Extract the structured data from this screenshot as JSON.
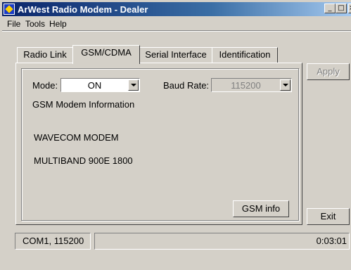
{
  "window": {
    "title": "ArWest Radio Modem  -  Dealer",
    "min": "_",
    "max": "□",
    "close": "×"
  },
  "menu": {
    "file": "File",
    "tools": "Tools",
    "help": "Help"
  },
  "tabs": [
    "Radio Link",
    "GSM/CDMA",
    "Serial Interface",
    "Identification"
  ],
  "active_tab": "GSM/CDMA",
  "gsm": {
    "mode_label": "Mode:",
    "mode_value": "ON",
    "baud_label": "Baud Rate:",
    "baud_value": "115200",
    "info_heading": "GSM Modem Information",
    "info_line1": "WAVECOM MODEM",
    "info_line2": "MULTIBAND  900E  1800",
    "gsm_info_button": "GSM info"
  },
  "buttons": {
    "apply": "Apply",
    "exit": "Exit"
  },
  "status": {
    "port": "COM1, 115200",
    "time": "0:03:01"
  }
}
